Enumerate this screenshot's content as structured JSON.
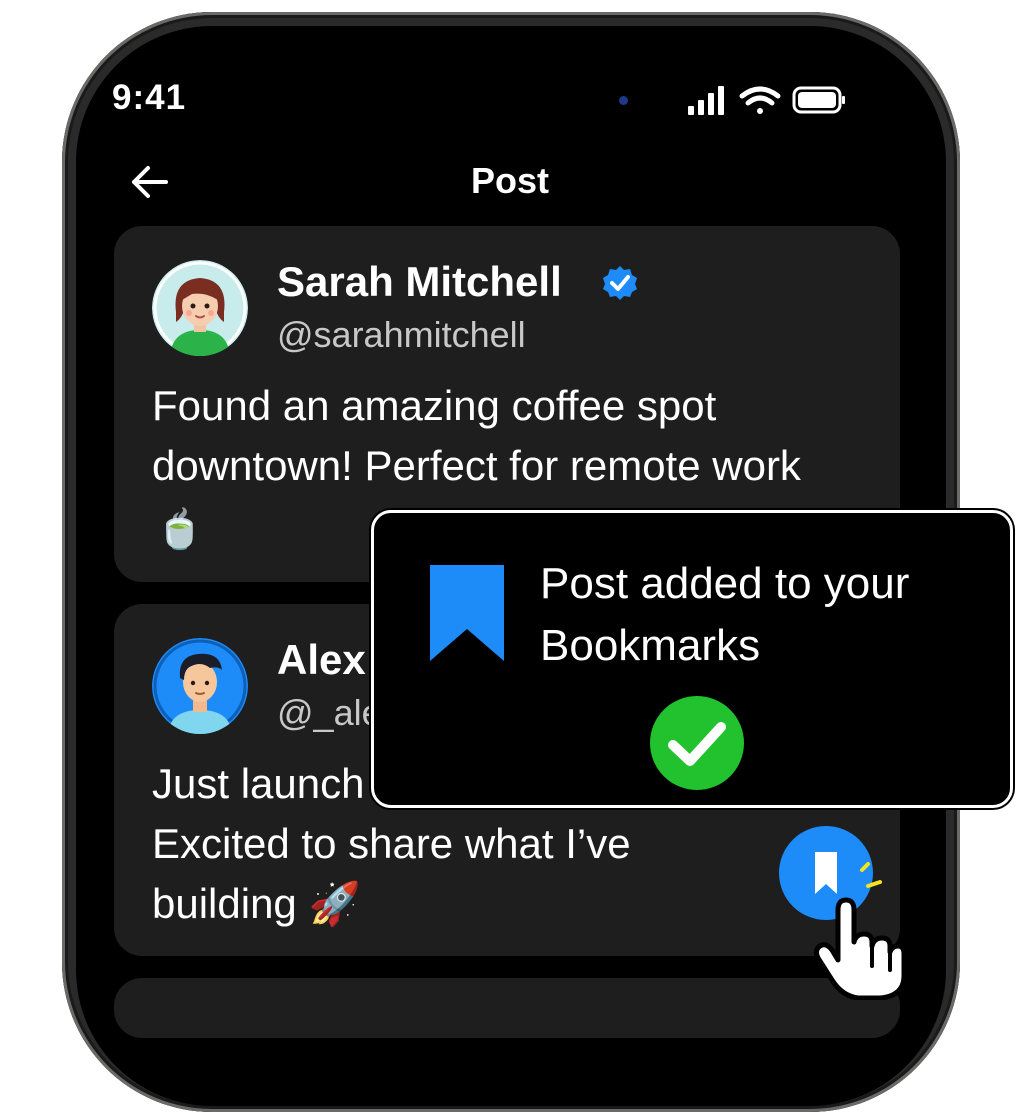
{
  "status_bar": {
    "time": "9:41",
    "icons": [
      "cellular-signal-icon",
      "wifi-icon",
      "battery-icon"
    ]
  },
  "header": {
    "back_icon": "arrow-left-icon",
    "title": "Post"
  },
  "posts": [
    {
      "name": "Sarah Mitchell",
      "handle": "@sarahmitchell",
      "verified": true,
      "lines": [
        "Found an amazing coffee spot",
        "downtown! Perfect for remote work",
        "🍵"
      ]
    },
    {
      "name": "Alex",
      "handle": "@_ale",
      "verified": false,
      "lines": [
        "Just launch",
        "Excited to share what I’ve",
        "building 🚀"
      ]
    }
  ],
  "toast": {
    "line1": "Post added to your",
    "line2": "Bookmarks",
    "icon": "bookmark-icon",
    "status_icon": "check-circle-icon"
  },
  "bookmark_button": {
    "icon": "bookmark-icon"
  },
  "colors": {
    "accent": "#1d8cf8",
    "success": "#22c22e",
    "card": "#1e1e1f",
    "background": "#000000"
  }
}
